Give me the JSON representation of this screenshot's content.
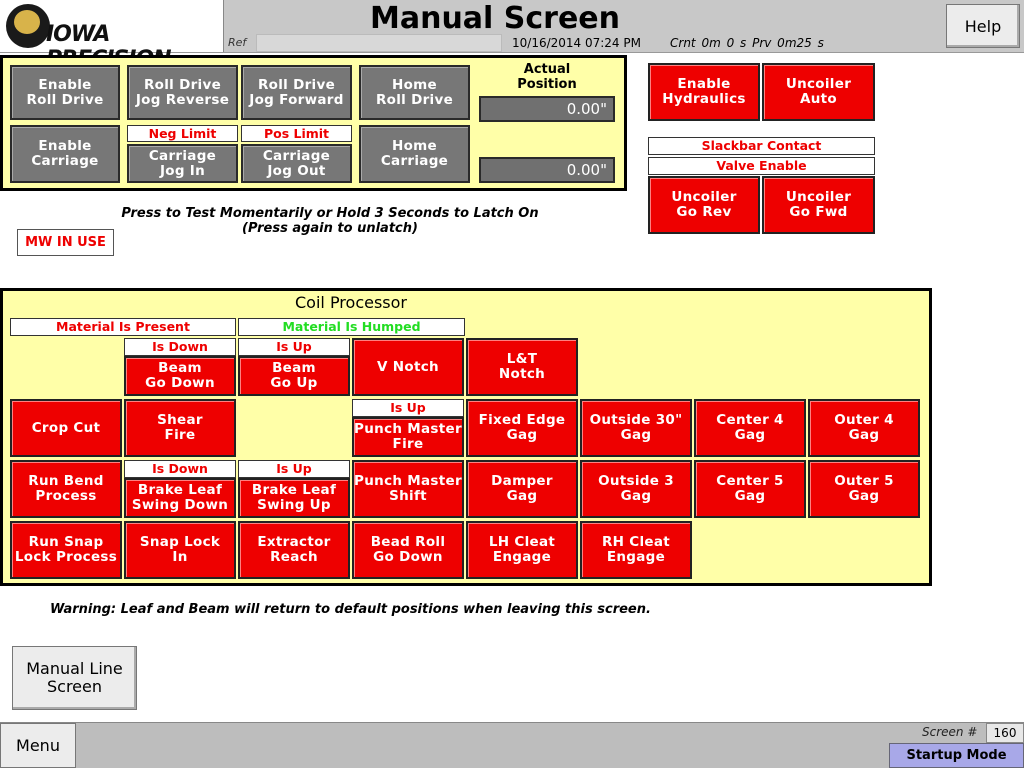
{
  "header": {
    "logo_text": "IOWA PRECISION",
    "title": "Manual Screen",
    "ref_label": "Ref",
    "datetime": "10/16/2014 07:24 PM",
    "timers": "Crnt  0m  0 s  Prv  0m25 s",
    "help_label": "Help"
  },
  "top_panel": {
    "enable_roll_drive": "Enable\nRoll Drive",
    "enable_carriage": "Enable\nCarriage",
    "roll_drive_jog_reverse": "Roll Drive\nJog Reverse",
    "roll_drive_jog_forward": "Roll Drive\nJog Forward",
    "neg_limit": "Neg Limit",
    "pos_limit": "Pos Limit",
    "carriage_jog_in": "Carriage\nJog In",
    "carriage_jog_out": "Carriage\nJog Out",
    "home_roll_drive": "Home\nRoll Drive",
    "home_carriage": "Home\nCarriage",
    "actual_position_label": "Actual\nPosition",
    "position1": "0.00\"",
    "position2": "0.00\""
  },
  "uncoiler": {
    "enable_hydraulics": "Enable\nHydraulics",
    "uncoiler_auto": "Uncoiler\nAuto",
    "slackbar_contact": "Slackbar Contact",
    "valve_enable": "Valve Enable",
    "uncoiler_go_rev": "Uncoiler\nGo Rev",
    "uncoiler_go_fwd": "Uncoiler\nGo Fwd"
  },
  "notes": {
    "press_test": "Press to Test Momentarily or Hold 3 Seconds to Latch On\n(Press again to unlatch)",
    "mw_in_use": "MW IN USE",
    "warning": "Warning: Leaf and Beam will return to default positions when leaving this screen."
  },
  "coil": {
    "title": "Coil Processor",
    "material_present": "Material Is Present",
    "material_humped": "Material Is Humped",
    "is_down": "Is Down",
    "is_up": "Is Up",
    "beam_go_down": "Beam\nGo Down",
    "beam_go_up": "Beam\nGo Up",
    "v_notch": "V Notch",
    "lt_notch": "L&T\nNotch",
    "crop_cut": "Crop Cut",
    "shear_fire": "Shear\nFire",
    "punch_master_fire": "Punch Master\nFire",
    "fixed_edge_gag": "Fixed Edge\nGag",
    "outside_30_gag": "Outside 30\"\nGag",
    "center_4_gag": "Center 4\nGag",
    "outer_4_gag": "Outer 4\nGag",
    "run_bend_process": "Run Bend\nProcess",
    "brake_leaf_swing_down": "Brake Leaf\nSwing Down",
    "brake_leaf_swing_up": "Brake Leaf\nSwing Up",
    "punch_master_shift": "Punch Master\nShift",
    "damper_gag": "Damper\nGag",
    "outside_3_gag": "Outside 3\nGag",
    "center_5_gag": "Center 5\nGag",
    "outer_5_gag": "Outer 5\nGag",
    "run_snap_lock_process": "Run Snap\nLock Process",
    "snap_lock_in": "Snap Lock\nIn",
    "extractor_reach": "Extractor\nReach",
    "bead_roll_go_down": "Bead Roll\nGo Down",
    "lh_cleat_engage": "LH Cleat\nEngage",
    "rh_cleat_engage": "RH Cleat\nEngage"
  },
  "footer": {
    "manual_line_screen": "Manual Line\nScreen",
    "menu_label": "Menu",
    "screen_label": "Screen #",
    "screen_number": "160",
    "mode": "Startup Mode"
  },
  "colors": {
    "panel_bg": "#ffffa8",
    "button_red": "#ee0000",
    "button_gray": "#777777",
    "label_red_text": "#ee0000",
    "label_green_text": "#22dd22",
    "mode_bg": "#a8a8e8"
  }
}
